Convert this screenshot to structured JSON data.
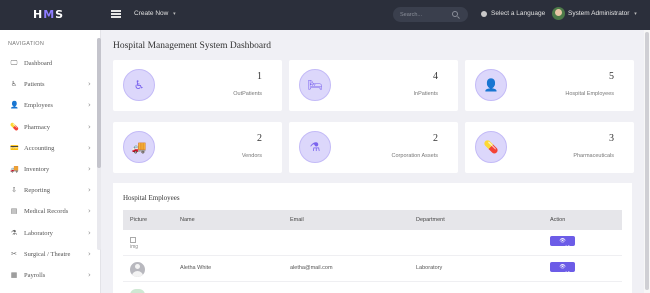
{
  "topbar": {
    "logo": {
      "left": "H",
      "mid": "M",
      "right": "S"
    },
    "create_label": "Create Now",
    "create_caret": "▾",
    "search_placeholder": "Search...",
    "language_label": "Select a Language",
    "user_name": "System Administrator",
    "user_caret": "▾"
  },
  "sidebar": {
    "heading": "NAVIGATION",
    "items": [
      {
        "label": "Dashboard",
        "icon": "🖵",
        "chevron": ""
      },
      {
        "label": "Patients",
        "icon": "♿",
        "chevron": "›"
      },
      {
        "label": "Employees",
        "icon": "👤",
        "chevron": "›"
      },
      {
        "label": "Pharmacy",
        "icon": "💊",
        "chevron": "›"
      },
      {
        "label": "Accounting",
        "icon": "💳",
        "chevron": "›"
      },
      {
        "label": "Inventory",
        "icon": "🚚",
        "chevron": "›"
      },
      {
        "label": "Reporting",
        "icon": "⇩",
        "chevron": "›"
      },
      {
        "label": "Medical Records",
        "icon": "▤",
        "chevron": "›"
      },
      {
        "label": "Laboratory",
        "icon": "⚗",
        "chevron": "›"
      },
      {
        "label": "Surgical / Theatre",
        "icon": "✂",
        "chevron": "›"
      },
      {
        "label": "Payrolls",
        "icon": "▦",
        "chevron": "›"
      }
    ]
  },
  "main": {
    "title": "Hospital Management System Dashboard",
    "cards": [
      {
        "number": "1",
        "caption": "OutPatients",
        "icon": "♿"
      },
      {
        "number": "4",
        "caption": "InPatients",
        "icon": "🛏"
      },
      {
        "number": "5",
        "caption": "Hospital Employees",
        "icon": "👤"
      },
      {
        "number": "2",
        "caption": "Vendors",
        "icon": "🚚"
      },
      {
        "number": "2",
        "caption": "Corporation Assets",
        "icon": "⚗"
      },
      {
        "number": "3",
        "caption": "Pharmaceuticals",
        "icon": "💊"
      }
    ],
    "employees": {
      "title": "Hospital Employees",
      "columns": [
        "Picture",
        "Name",
        "Email",
        "Department",
        "Action"
      ],
      "rows": [
        {
          "picture": "img",
          "name": "",
          "email": "",
          "department": "",
          "action": "View"
        },
        {
          "picture": "",
          "name": "Aletha White",
          "email": "aletha@mail.com",
          "department": "Laboratory",
          "action": "View"
        }
      ]
    }
  },
  "colors": {
    "accent": "#6c5ce7",
    "topbar": "#2b2f3b",
    "icon_circle": "#dcd7fb"
  }
}
